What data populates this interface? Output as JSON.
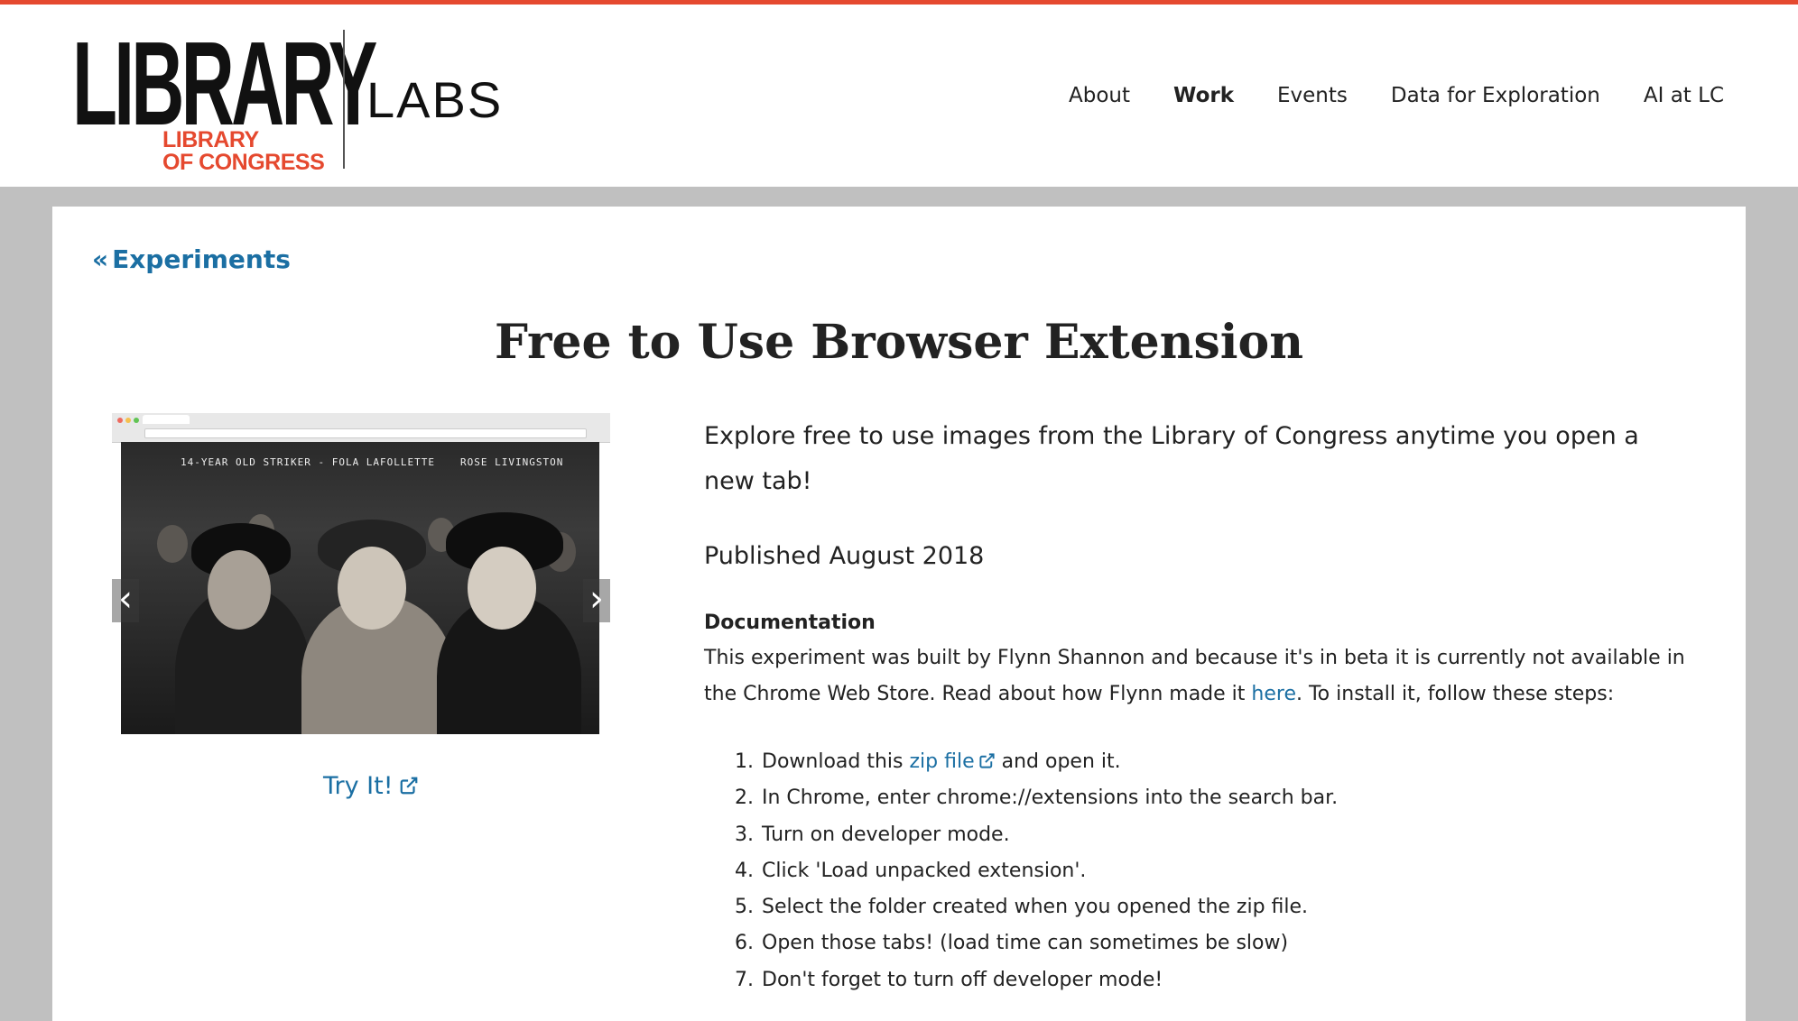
{
  "header": {
    "logo_word": "LIBRARY",
    "logo_sub_line1": "LIBRARY",
    "logo_sub_line2": "OF CONGRESS",
    "logo_labs": "LABS",
    "nav": [
      {
        "label": "About",
        "active": false
      },
      {
        "label": "Work",
        "active": true
      },
      {
        "label": "Events",
        "active": false
      },
      {
        "label": "Data for Exploration",
        "active": false
      },
      {
        "label": "AI at LC",
        "active": false
      }
    ]
  },
  "breadcrumb": {
    "icon": "double-chevron-left-icon",
    "label": "Experiments"
  },
  "page": {
    "title": "Free to Use Browser Extension"
  },
  "carousel": {
    "photo_caption_left": "14-YEAR OLD STRIKER - FOLA LAFOLLETTE",
    "photo_caption_right": "ROSE LIVINGSTON",
    "prev_icon": "chevron-left-icon",
    "next_icon": "chevron-right-icon",
    "prev_glyph": "‹",
    "next_glyph": "›"
  },
  "try_it": {
    "label": "Try It!",
    "icon": "external-link-icon"
  },
  "intro": "Explore free to use images from the Library of Congress anytime you open a new tab!",
  "published": "Published August 2018",
  "documentation": {
    "heading": "Documentation",
    "text_before_link": "This experiment was built by Flynn Shannon and because it's in beta it is currently not available in the Chrome Web Store. Read about how Flynn made it ",
    "link_label": "here",
    "text_after_link": ". To install it, follow these steps:",
    "steps": [
      {
        "before": "Download this ",
        "link": "zip file",
        "after": " and open it."
      },
      {
        "before": "In Chrome, enter chrome://extensions into the search bar.",
        "link": "",
        "after": ""
      },
      {
        "before": "Turn on developer mode.",
        "link": "",
        "after": ""
      },
      {
        "before": "Click 'Load unpacked extension'.",
        "link": "",
        "after": ""
      },
      {
        "before": "Select the folder created when you opened the zip file.",
        "link": "",
        "after": ""
      },
      {
        "before": "Open those tabs! (load time can sometimes be slow)",
        "link": "",
        "after": ""
      },
      {
        "before": "Don't forget to turn off developer mode!",
        "link": "",
        "after": ""
      }
    ]
  },
  "colors": {
    "brand_red": "#e5492f",
    "link_blue": "#1b6fa3",
    "page_gray": "#c0c0c0"
  }
}
